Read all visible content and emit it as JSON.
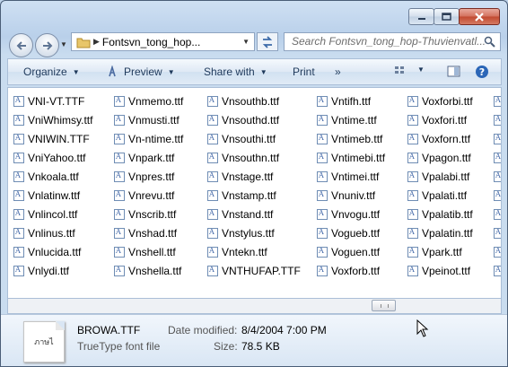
{
  "window": {
    "caption_buttons": [
      "minimize",
      "maximize",
      "close"
    ]
  },
  "address_bar": {
    "path_label": "Fontsvn_tong_hop..."
  },
  "search": {
    "placeholder": "Search Fontsvn_tong_hop-Thuvienvatl..."
  },
  "toolbar": {
    "organize": "Organize",
    "preview": "Preview",
    "share_with": "Share with",
    "print": "Print",
    "more": "»"
  },
  "files": {
    "columns": [
      [
        "VNI-VT.TTF",
        "VniWhimsy.ttf",
        "VNIWIN.TTF",
        "VniYahoo.ttf",
        "Vnkoala.ttf",
        "Vnlatinw.ttf",
        "Vnlincol.ttf",
        "Vnlinus.ttf",
        "Vnlucida.ttf",
        "Vnlydi.ttf"
      ],
      [
        "Vnmemo.ttf",
        "Vnmusti.ttf",
        "Vn-ntime.ttf",
        "Vnpark.ttf",
        "Vnpres.ttf",
        "Vnrevu.ttf",
        "Vnscrib.ttf",
        "Vnshad.ttf",
        "Vnshell.ttf",
        "Vnshella.ttf"
      ],
      [
        "Vnsouthb.ttf",
        "Vnsouthd.ttf",
        "Vnsouthi.ttf",
        "Vnsouthn.ttf",
        "Vnstage.ttf",
        "Vnstamp.ttf",
        "Vnstand.ttf",
        "Vnstylus.ttf",
        "Vntekn.ttf",
        "VNTHUFAP.TTF"
      ],
      [
        "Vntifh.ttf",
        "Vntime.ttf",
        "Vntimeb.ttf",
        "Vntimebi.ttf",
        "Vntimei.ttf",
        "Vnuniv.ttf",
        "Vnvogu.ttf",
        "Vogueb.ttf",
        "Voguen.ttf",
        "Voxforb.ttf"
      ],
      [
        "Voxforbi.ttf",
        "Voxfori.ttf",
        "Voxforn.ttf",
        "Vpagon.ttf",
        "Vpalabi.ttf",
        "Vpalati.ttf",
        "Vpalatib.ttf",
        "Vpalatin.ttf",
        "Vpark.ttf",
        "Vpeinot.ttf"
      ]
    ]
  },
  "details": {
    "file_name": "BROWA.TTF",
    "file_type": "TrueType font file",
    "preview_text": "ภาษไ",
    "date_modified_label": "Date modified:",
    "date_modified_value": "8/4/2004 7:00 PM",
    "size_label": "Size:",
    "size_value": "78.5 KB"
  },
  "icons": {
    "back": "back-arrow-icon",
    "forward": "forward-arrow-icon",
    "folder": "folder-icon",
    "refresh": "refresh-icon",
    "search": "search-icon",
    "preview": "preview-icon",
    "views": "views-icon",
    "help": "help-icon",
    "font_file": "font-file-icon"
  },
  "colors": {
    "toolbar_text": "#1e395b",
    "close_button": "#c1482f"
  }
}
